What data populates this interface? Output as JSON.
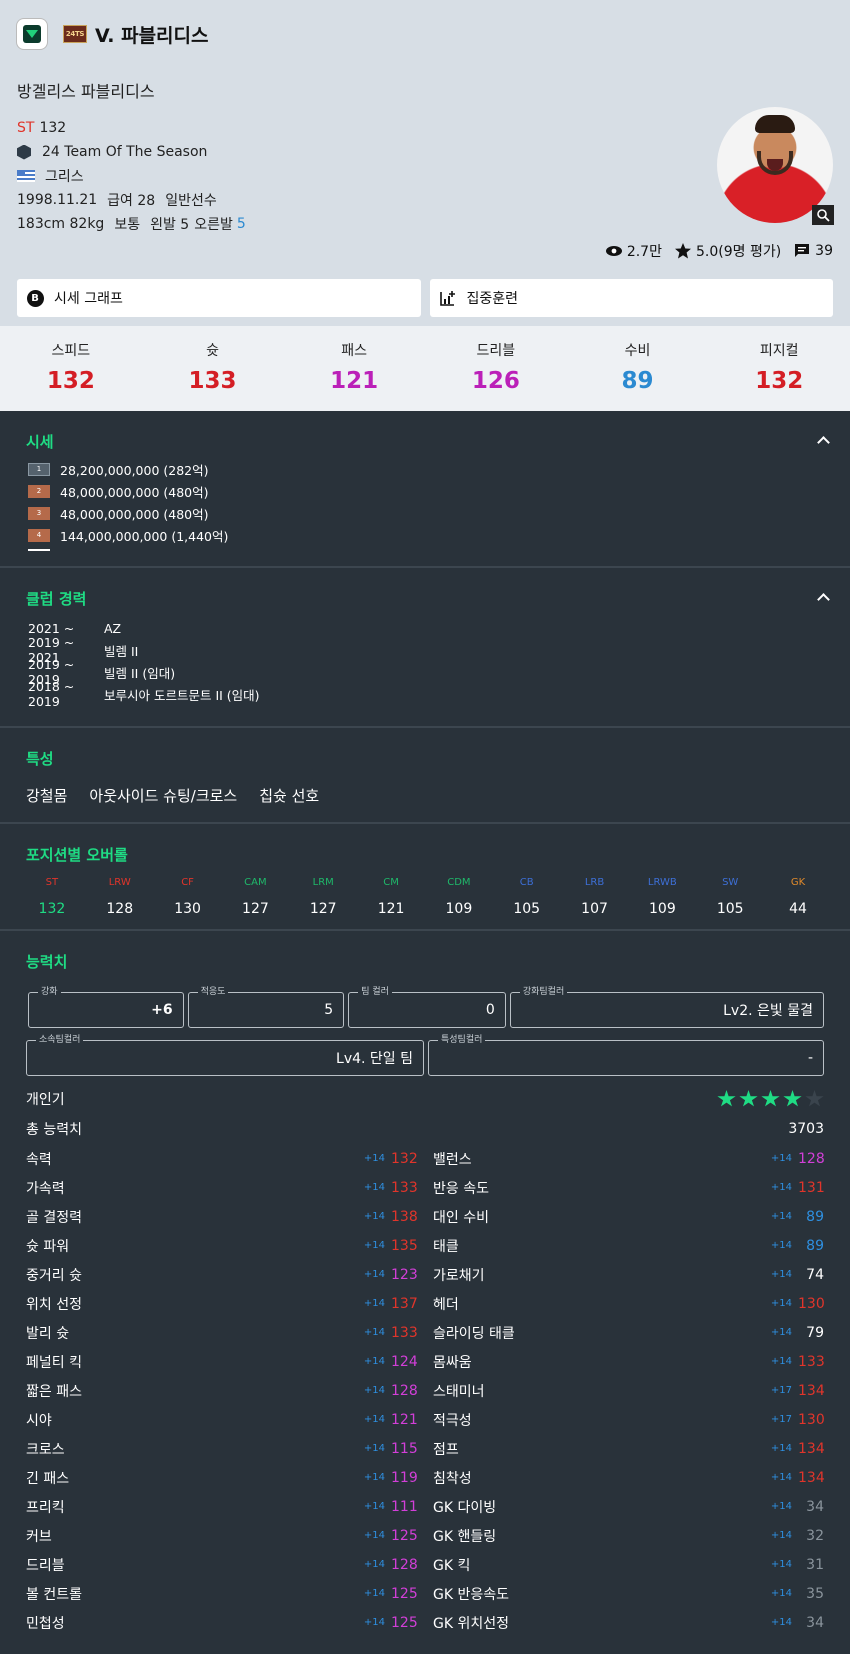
{
  "header": {
    "season_badge": "24TS",
    "player_title": "V. 파블리디스",
    "full_name": "방겔리스 파블리디스",
    "position": "ST",
    "position_ovr": "132",
    "season_name": "24 Team Of The Season",
    "nationality": "그리스",
    "birthdate": "1998.11.21",
    "salary": "급여 28",
    "player_type": "일반선수",
    "height_weight": "183cm 82kg",
    "body_type": "보통",
    "left_foot": "왼발 5",
    "right_foot_label": "오른발",
    "right_foot_value": "5",
    "views": "2.7만",
    "rating": "5.0(9명 평가)",
    "comments": "39"
  },
  "buttons": {
    "price_graph": "시세 그래프",
    "training": "집중훈련"
  },
  "stats": [
    {
      "label": "스피드",
      "value": "132",
      "color": "#d41e25"
    },
    {
      "label": "슛",
      "value": "133",
      "color": "#d41e25"
    },
    {
      "label": "패스",
      "value": "121",
      "color": "#bb20b8"
    },
    {
      "label": "드리블",
      "value": "126",
      "color": "#bb20b8"
    },
    {
      "label": "수비",
      "value": "89",
      "color": "#2b8ad1"
    },
    {
      "label": "피지컬",
      "value": "132",
      "color": "#d41e25"
    }
  ],
  "price": {
    "title": "시세",
    "rows": [
      {
        "badge": "1",
        "text": "28,200,000,000 (282억)"
      },
      {
        "badge": "2",
        "text": "48,000,000,000 (480억)"
      },
      {
        "badge": "3",
        "text": "48,000,000,000 (480억)"
      },
      {
        "badge": "4",
        "text": "144,000,000,000 (1,440억)"
      }
    ]
  },
  "clubs": {
    "title": "클럽 경력",
    "rows": [
      {
        "years": "2021 ~",
        "club": "AZ"
      },
      {
        "years": "2019 ~ 2021",
        "club": "빌렘 II"
      },
      {
        "years": "2019 ~ 2019",
        "club": "빌렘 II (임대)"
      },
      {
        "years": "2018 ~ 2019",
        "club": "보루시아 도르트문트 II (임대)"
      }
    ]
  },
  "traits": {
    "title": "특성",
    "items": [
      "강철몸",
      "아웃사이드 슈팅/크로스",
      "칩슛 선호"
    ]
  },
  "positions": {
    "title": "포지션별 오버롤",
    "items": [
      {
        "pos": "ST",
        "val": "132",
        "color": "#e0352b",
        "vcolor": "#1fdc84"
      },
      {
        "pos": "LRW",
        "val": "128",
        "color": "#e0352b",
        "vcolor": "#ffffff"
      },
      {
        "pos": "CF",
        "val": "130",
        "color": "#e0352b",
        "vcolor": "#ffffff"
      },
      {
        "pos": "CAM",
        "val": "127",
        "color": "#1fb86a",
        "vcolor": "#ffffff"
      },
      {
        "pos": "LRM",
        "val": "127",
        "color": "#1fb86a",
        "vcolor": "#ffffff"
      },
      {
        "pos": "CM",
        "val": "121",
        "color": "#1fb86a",
        "vcolor": "#ffffff"
      },
      {
        "pos": "CDM",
        "val": "109",
        "color": "#1fb86a",
        "vcolor": "#ffffff"
      },
      {
        "pos": "CB",
        "val": "105",
        "color": "#3d6fd6",
        "vcolor": "#ffffff"
      },
      {
        "pos": "LRB",
        "val": "107",
        "color": "#3d6fd6",
        "vcolor": "#ffffff"
      },
      {
        "pos": "LRWB",
        "val": "109",
        "color": "#3d6fd6",
        "vcolor": "#ffffff"
      },
      {
        "pos": "SW",
        "val": "105",
        "color": "#3d6fd6",
        "vcolor": "#ffffff"
      },
      {
        "pos": "GK",
        "val": "44",
        "color": "#e08a2b",
        "vcolor": "#ffffff"
      }
    ]
  },
  "abilities": {
    "title": "능력치",
    "fields": {
      "enhance_label": "강화",
      "enhance": "+6",
      "adapt_label": "적응도",
      "adapt": "5",
      "teamcolor_label": "팀 컬러",
      "teamcolor": "0",
      "enh_team_label": "강화팀컬러",
      "enh_team": "Lv2. 은빛 물결",
      "club_team_label": "소속팀컬러",
      "club_team": "Lv4. 단일 팀",
      "trait_team_label": "특성팀컬러",
      "trait_team": "-"
    },
    "popularity_label": "개인기",
    "popularity_stars": 4,
    "total_label": "총 능력치",
    "total": "3703",
    "left": [
      {
        "name": "속력",
        "delta": "+14",
        "value": "132",
        "color": "#e0352b"
      },
      {
        "name": "가속력",
        "delta": "+14",
        "value": "133",
        "color": "#e0352b"
      },
      {
        "name": "골 결정력",
        "delta": "+14",
        "value": "138",
        "color": "#e0352b"
      },
      {
        "name": "슛 파워",
        "delta": "+14",
        "value": "135",
        "color": "#e0352b"
      },
      {
        "name": "중거리 슛",
        "delta": "+14",
        "value": "123",
        "color": "#d23fd8"
      },
      {
        "name": "위치 선정",
        "delta": "+14",
        "value": "137",
        "color": "#e0352b"
      },
      {
        "name": "발리 슛",
        "delta": "+14",
        "value": "133",
        "color": "#e0352b"
      },
      {
        "name": "페널티 킥",
        "delta": "+14",
        "value": "124",
        "color": "#d23fd8"
      },
      {
        "name": "짧은 패스",
        "delta": "+14",
        "value": "128",
        "color": "#d23fd8"
      },
      {
        "name": "시야",
        "delta": "+14",
        "value": "121",
        "color": "#d23fd8"
      },
      {
        "name": "크로스",
        "delta": "+14",
        "value": "115",
        "color": "#d23fd8"
      },
      {
        "name": "긴 패스",
        "delta": "+14",
        "value": "119",
        "color": "#d23fd8"
      },
      {
        "name": "프리킥",
        "delta": "+14",
        "value": "111",
        "color": "#d23fd8"
      },
      {
        "name": "커브",
        "delta": "+14",
        "value": "125",
        "color": "#d23fd8"
      },
      {
        "name": "드리블",
        "delta": "+14",
        "value": "128",
        "color": "#d23fd8"
      },
      {
        "name": "볼 컨트롤",
        "delta": "+14",
        "value": "125",
        "color": "#d23fd8"
      },
      {
        "name": "민첩성",
        "delta": "+14",
        "value": "125",
        "color": "#d23fd8"
      }
    ],
    "right": [
      {
        "name": "밸런스",
        "delta": "+14",
        "value": "128",
        "color": "#d23fd8"
      },
      {
        "name": "반응 속도",
        "delta": "+14",
        "value": "131",
        "color": "#e0352b"
      },
      {
        "name": "대인 수비",
        "delta": "+14",
        "value": "89",
        "color": "#2e8fe0"
      },
      {
        "name": "태클",
        "delta": "+14",
        "value": "89",
        "color": "#2e8fe0"
      },
      {
        "name": "가로채기",
        "delta": "+14",
        "value": "74",
        "color": "#ffffff"
      },
      {
        "name": "헤더",
        "delta": "+14",
        "value": "130",
        "color": "#e0352b"
      },
      {
        "name": "슬라이딩 태클",
        "delta": "+14",
        "value": "79",
        "color": "#ffffff"
      },
      {
        "name": "몸싸움",
        "delta": "+14",
        "value": "133",
        "color": "#e0352b"
      },
      {
        "name": "스태미너",
        "delta": "+17",
        "value": "134",
        "color": "#e0352b"
      },
      {
        "name": "적극성",
        "delta": "+17",
        "value": "130",
        "color": "#e0352b"
      },
      {
        "name": "점프",
        "delta": "+14",
        "value": "134",
        "color": "#e0352b"
      },
      {
        "name": "침착성",
        "delta": "+14",
        "value": "134",
        "color": "#e0352b"
      },
      {
        "name": "GK 다이빙",
        "delta": "+14",
        "value": "34",
        "color": "#8a949c"
      },
      {
        "name": "GK 핸들링",
        "delta": "+14",
        "value": "32",
        "color": "#8a949c"
      },
      {
        "name": "GK 킥",
        "delta": "+14",
        "value": "31",
        "color": "#8a949c"
      },
      {
        "name": "GK 반응속도",
        "delta": "+14",
        "value": "35",
        "color": "#8a949c"
      },
      {
        "name": "GK 위치선정",
        "delta": "+14",
        "value": "34",
        "color": "#8a949c"
      }
    ]
  }
}
